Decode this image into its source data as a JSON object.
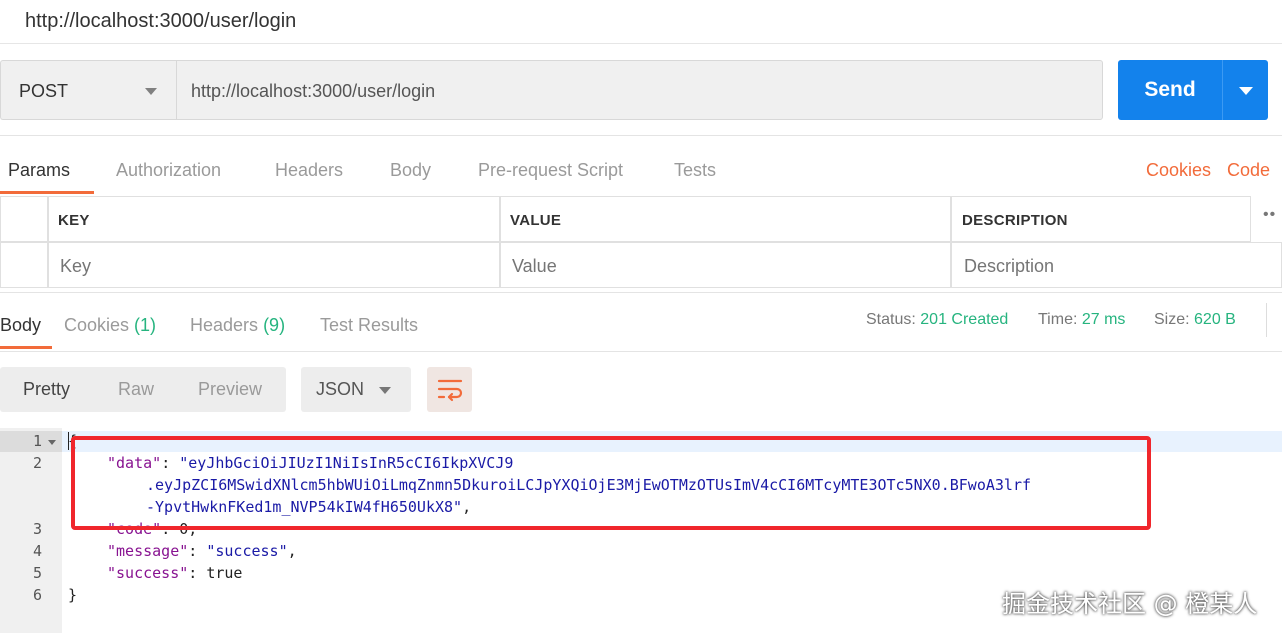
{
  "window": {
    "title": "http://localhost:3000/user/login"
  },
  "request": {
    "method": "POST",
    "url": "http://localhost:3000/user/login",
    "send_label": "Send"
  },
  "request_tabs": {
    "items": [
      "Params",
      "Authorization",
      "Headers",
      "Body",
      "Pre-request Script",
      "Tests"
    ],
    "active": "Params",
    "links": [
      "Cookies",
      "Code"
    ]
  },
  "params_table": {
    "columns": [
      "KEY",
      "VALUE",
      "DESCRIPTION"
    ],
    "placeholders": {
      "key": "Key",
      "value": "Value",
      "description": "Description"
    }
  },
  "response_tabs": {
    "items": [
      {
        "label": "Body",
        "count": ""
      },
      {
        "label": "Cookies",
        "count": "(1)"
      },
      {
        "label": "Headers",
        "count": "(9)"
      },
      {
        "label": "Test Results",
        "count": ""
      }
    ],
    "active": "Body"
  },
  "status": {
    "status_label": "Status:",
    "status_value": "201 Created",
    "time_label": "Time:",
    "time_value": "27 ms",
    "size_label": "Size:",
    "size_value": "620 B"
  },
  "view_modes": {
    "items": [
      "Pretty",
      "Raw",
      "Preview"
    ],
    "active": "Pretty"
  },
  "format": {
    "selected": "JSON"
  },
  "response_body": {
    "line_numbers": [
      "1",
      "2",
      "3",
      "4",
      "5",
      "6"
    ],
    "open_brace": "{",
    "close_brace": "}",
    "data_key": "\"data\"",
    "data_value_line1": "\"eyJhbGciOiJIUzI1NiIsInR5cCI6IkpXVCJ9",
    "data_value_line2": ".eyJpZCI6MSwidXNlcm5hbWUiOiLmqZnmn5DkuroiLCJpYXQiOjE3MjEwOTMzOTUsImV4cCI6MTcyMTE3OTc5NX0.BFwoA3lrf",
    "data_value_line3": "-YpvtHwknFKed1m_NVP54kIW4fH650UkX8\"",
    "code_key": "\"code\"",
    "code_value": "0",
    "message_key": "\"message\"",
    "message_value": "\"success\"",
    "success_key": "\"success\"",
    "success_value": "true"
  },
  "watermark": "掘金技术社区 @ 橙某人",
  "colors": {
    "accent": "#f26b3a",
    "send_button": "#1382ec",
    "status_green": "#26b47f",
    "annotation_red": "#f0262c"
  },
  "icons": [
    "chevron-down-icon",
    "wrap-lines-icon",
    "more-options-icon",
    "fold-arrow-icon"
  ]
}
